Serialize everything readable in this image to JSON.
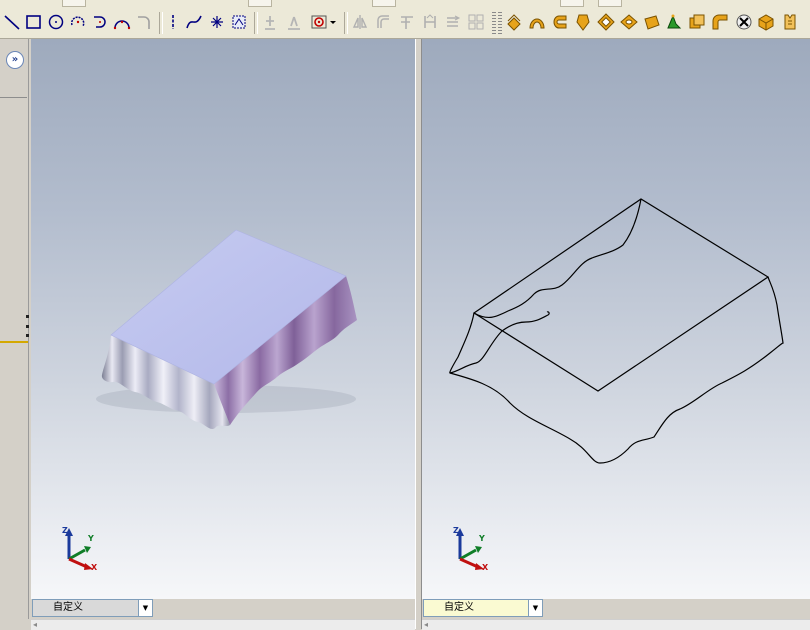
{
  "toolbar": {
    "sketch_tools": [
      "line-icon",
      "rectangle-icon",
      "circle-icon",
      "centerpoint-arc-icon",
      "tangent-arc-icon",
      "three-point-arc-icon",
      "sketch-fillet-icon",
      "spline-icon",
      "point-icon",
      "convert-entities-icon",
      "smart-dimension-icon",
      "relations-icon",
      "display-delete-relations-icon"
    ],
    "disabled_tools": [
      "mirror-icon",
      "offset-icon",
      "trim-icon",
      "extend-icon",
      "move-icon",
      "linear-pattern-icon"
    ],
    "feature_tools": [
      "extruded-boss-icon",
      "revolved-boss-icon",
      "swept-boss-icon",
      "lofted-boss-icon",
      "extruded-cut-icon",
      "revolved-cut-icon",
      "fillet-icon",
      "shell-icon",
      "draft-icon",
      "rib-icon",
      "hole-wizard-icon",
      "sheet-metal-icon"
    ]
  },
  "left_panel": {
    "expand_label": "»"
  },
  "viewports": [
    {
      "name": "shaded-view",
      "orientation_label": "自定义",
      "triad": {
        "z": "Z",
        "y": "Y",
        "x": "X"
      }
    },
    {
      "name": "wireframe-view",
      "orientation_label": "自定义",
      "triad": {
        "z": "Z",
        "y": "Y",
        "x": "X"
      }
    }
  ],
  "colors": {
    "toolbar_bg": "#ece9d8",
    "viewport_top": "#9eaabd",
    "viewport_bottom": "#f6f7f9",
    "cloth": "#a8aee0",
    "selector_right": "#fafad2",
    "selector_left": "#d9d9d9"
  }
}
